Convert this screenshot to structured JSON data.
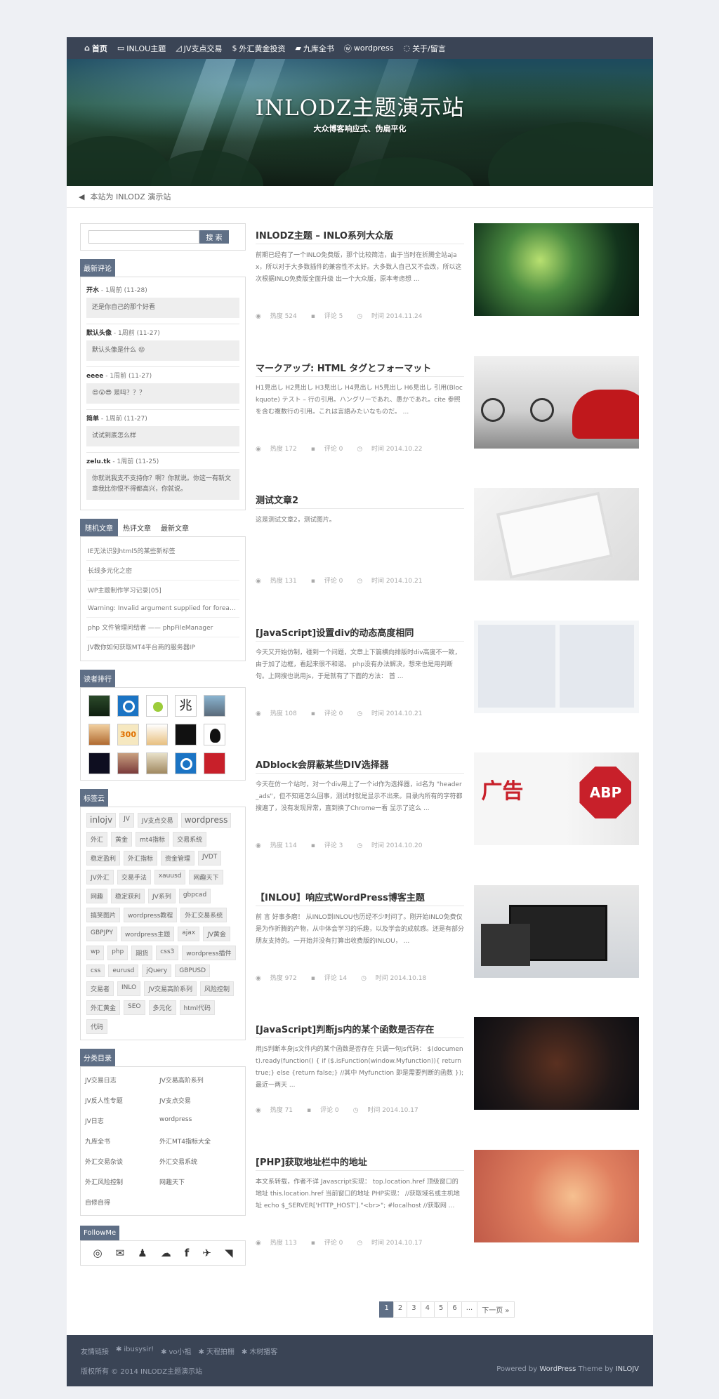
{
  "nav": [
    {
      "icon": "home-icon",
      "glyph": "⌂",
      "label": "首页"
    },
    {
      "icon": "monitor-icon",
      "glyph": "▭",
      "label": "INLOU主题"
    },
    {
      "icon": "chart-icon",
      "glyph": "◿",
      "label": "JV支点交易"
    },
    {
      "icon": "dollar-icon",
      "glyph": "$",
      "label": "外汇黄金投资"
    },
    {
      "icon": "book-icon",
      "glyph": "▰",
      "label": "九库全书"
    },
    {
      "icon": "wordpress-icon",
      "glyph": "ⓦ",
      "label": "wordpress"
    },
    {
      "icon": "chat-icon",
      "glyph": "◌",
      "label": "关于/留言"
    }
  ],
  "banner": {
    "title": "INLODZ主题演示站",
    "subtitle": "大众博客响应式、伪扁平化"
  },
  "notice": "本站为 INLODZ 演示站",
  "search": {
    "placeholder": "",
    "button": "搜 索"
  },
  "recent_comments": {
    "title": "最新评论",
    "items": [
      {
        "author": "开水",
        "time": " - 1周前 (11-28)",
        "text": "还是你自己的那个好看"
      },
      {
        "author": "默认头像",
        "time": " - 1周前 (11-27)",
        "text": "默认头像是什么 😝"
      },
      {
        "author": "eeee",
        "time": " - 1周前 (11-27)",
        "text": "😍😲😎 是吗？？？"
      },
      {
        "author": "简单",
        "time": " - 1周前 (11-27)",
        "text": "试试到底怎么样"
      },
      {
        "author": "zelu.tk",
        "time": " - 1周前 (11-25)",
        "text": "你就说我支不支持你？啊？你就说。你这一有新文章我比你恨不得都高兴，你就说。"
      }
    ]
  },
  "tabs": {
    "labels": [
      "随机文章",
      "热评文章",
      "最新文章"
    ],
    "items": [
      "IE无法识别html5的某些新标签",
      "长线多元化之密",
      "WP主题制作学习记录[05]",
      "Warning: Invalid argument supplied for foreach()",
      "php 文件管理问结者 —— phpFileManager",
      "JV教你如何获取MT4平台商的服务器IP"
    ]
  },
  "readers": {
    "title": "读者排行"
  },
  "tagcloud": {
    "title": "标签云",
    "tags": [
      "inlojv",
      "JV",
      "JV支点交易",
      "wordpress",
      "外汇",
      "黄金",
      "mt4指标",
      "交易系统",
      "稳定盈利",
      "外汇指标",
      "资金管理",
      "JVDT",
      "JV外汇",
      "交易手法",
      "xauusd",
      "网趣天下",
      "网趣",
      "稳定获利",
      "JV系列",
      "gbpcad",
      "搞笑图片",
      "wordpress教程",
      "外汇交易系统",
      "GBPJPY",
      "wordpress主题",
      "ajax",
      "JV黄金",
      "wp",
      "php",
      "期货",
      "css3",
      "wordpress插件",
      "css",
      "eurusd",
      "jQuery",
      "GBPUSD",
      "交易者",
      "INLO",
      "JV交易高阶系列",
      "风险控制",
      "外汇黄金",
      "SEO",
      "多元化",
      "html代码",
      "代码"
    ]
  },
  "categories": {
    "title": "分类目录",
    "items": [
      "JV交易日志",
      "JV交易高阶系列",
      "JV反人性专题",
      "JV支点交易",
      "JV日志",
      "wordpress",
      "九库全书",
      "外汇MT4指标大全",
      "外汇交易杂谈",
      "外汇交易系统",
      "外汇风险控制",
      "网趣天下",
      "自修自得"
    ]
  },
  "followme": {
    "title": "FollowMe"
  },
  "posts": [
    {
      "title": "INLODZ主题 – INLO系列大众版",
      "excerpt": "前期已经有了一个INLO免费版，那个比较简洁，由于当时在折腾全站ajax，所以对于大多数插件的兼容性不太好。大多数人自己又不会改，所以这次根据INLO免费版全面升级 出一个大众版，原本考虑想 ...",
      "views": "热度 524",
      "comments": "评论 5",
      "date": "时间 2014.11.24"
    },
    {
      "title": "マークアップ: HTML タグとフォーマット",
      "excerpt": "H1見出し H2見出し H3見出し H4見出し H5見出し H6見出し 引用(Blockquote) テスト – 行の引用。ハングリーであれ、愚かであれ。cite 参照を含む複数行の引用。これは言語みたいなものだ。 ...",
      "views": "热度 172",
      "comments": "评论 0",
      "date": "时间 2014.10.22"
    },
    {
      "title": "测试文章2",
      "excerpt": "这是测试文章2，测试图片。",
      "views": "热度 131",
      "comments": "评论 0",
      "date": "时间 2014.10.21"
    },
    {
      "title": "[JavaScript]设置div的动态高度相同",
      "excerpt": "今天又开始仿制，碰到一个问题，文章上下篇横向排版时div高度不一致，由于加了边框，看起来很不和谐。 php没有办法解决，想来也是用判断句。上网搜也说用js，于是就有了下面的方法： 首 ...",
      "views": "热度 108",
      "comments": "评论 0",
      "date": "时间 2014.10.21"
    },
    {
      "title": "ADblock会屏蔽某些DIV选择器",
      "excerpt": "今天在仿一个站时，对一个div用上了一个id作为选择器，id名为 \"header_ads\"，但不知道怎么回事，测试时就是显示不出来。目录内所有的字符都搜遍了，没有发现异常，直到换了Chrome一看 显示了这么 ...",
      "views": "热度 114",
      "comments": "评论 3",
      "date": "时间 2014.10.20"
    },
    {
      "title": "【INLOU】响应式WordPress博客主题",
      "excerpt": "前 言 好事多磨！ 从INLO到INLOU也历经不少时间了。刚开始INLO免费仅是为作折腾的产物，从中体会学习的乐趣，以及学会的成就感。还是有部分朋友支持的。一开始并没有打算出收费版的INLOU， ...",
      "views": "热度 972",
      "comments": "评论 14",
      "date": "时间 2014.10.18"
    },
    {
      "title": "[JavaScript]判断js内的某个函数是否存在",
      "excerpt": "用JS判断本身js文件内的某个函数是否存在 只调一句js代码： $(document).ready(function() { if ($.isFunction(window.Myfunction)){ return true;} else {return false;} //其中 Myfunction 即是需要判断的函数 }); 最近一两天 ...",
      "views": "热度 71",
      "comments": "评论 0",
      "date": "时间 2014.10.17"
    },
    {
      "title": "[PHP]获取地址栏中的地址",
      "excerpt": "本文系转载，作者不详 Javascript实现： top.location.href 顶级窗口的地址 this.location.href 当前窗口的地址 PHP实现： //获取域名或主机地址 echo $_SERVER['HTTP_HOST'].\"<br>\"; #localhost //获取网 ...",
      "views": "热度 113",
      "comments": "评论 0",
      "date": "时间 2014.10.17"
    }
  ],
  "pagination": [
    "1",
    "2",
    "3",
    "4",
    "5",
    "6",
    "...",
    "下一页 »"
  ],
  "footer": {
    "links_label": "友情链接",
    "links": [
      "ibusysir!",
      "vo小祖",
      "天程拍棚",
      "木树播客"
    ],
    "copyright": "版权所有 © 2014 INLODZ主题演示站",
    "powered_prefix": "Powered by ",
    "powered_wp": "WordPress",
    "theme_prefix": " Theme by ",
    "theme_author": "INLOJV"
  }
}
